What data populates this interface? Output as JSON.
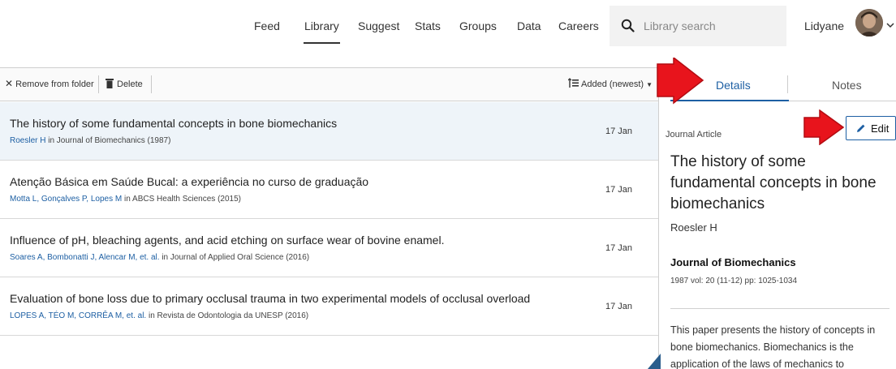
{
  "nav": {
    "links": [
      "Feed",
      "Library",
      "Suggest",
      "Stats",
      "Groups",
      "Data",
      "Careers"
    ],
    "search_placeholder": "Library search",
    "user_name": "Lidyane"
  },
  "toolbar": {
    "remove_label": "Remove from folder",
    "delete_label": "Delete",
    "sort_label": "Added (newest)"
  },
  "documents": [
    {
      "title": "The history of some fundamental concepts in bone biomechanics",
      "authors": "Roesler H",
      "source": " in Journal of Biomechanics (1987)",
      "date": "17 Jan",
      "selected": true
    },
    {
      "title": "Atenção Básica em Saúde Bucal: a experiência no curso de graduação",
      "authors": "Motta L, Gonçalves P, Lopes M",
      "source": " in ABCS Health Sciences (2015)",
      "date": "17 Jan",
      "selected": false
    },
    {
      "title": "Influence of pH, bleaching agents, and acid etching on surface wear of bovine enamel.",
      "authors": "Soares A, Bombonatti J, Alencar M, et. al.",
      "source": " in Journal of Applied Oral Science (2016)",
      "date": "17 Jan",
      "selected": false
    },
    {
      "title": "Evaluation of bone loss due to primary occlusal trauma in two experimental models of occlusal overload",
      "authors": "LOPES A, TÉO M, CORRÊA M, et. al.",
      "source": " in Revista de Odontologia da UNESP (2016)",
      "date": "17 Jan",
      "selected": false
    }
  ],
  "details": {
    "tab_details": "Details",
    "tab_notes": "Notes",
    "edit_label": "Edit",
    "doc_type": "Journal Article",
    "title": "The history of some fundamental concepts in bone biomechanics",
    "author": "Roesler H",
    "journal": "Journal of Biomechanics",
    "citation": "1987 vol: 20 (11-12) pp: 1025-1034",
    "abstract": "This paper presents the history of concepts in bone biomechanics. Biomechanics is the application of the laws of mechanics to"
  },
  "colors": {
    "accent": "#1d5fa3",
    "annotation_arrow": "#e8141c",
    "selected_row": "#eef4f9"
  }
}
